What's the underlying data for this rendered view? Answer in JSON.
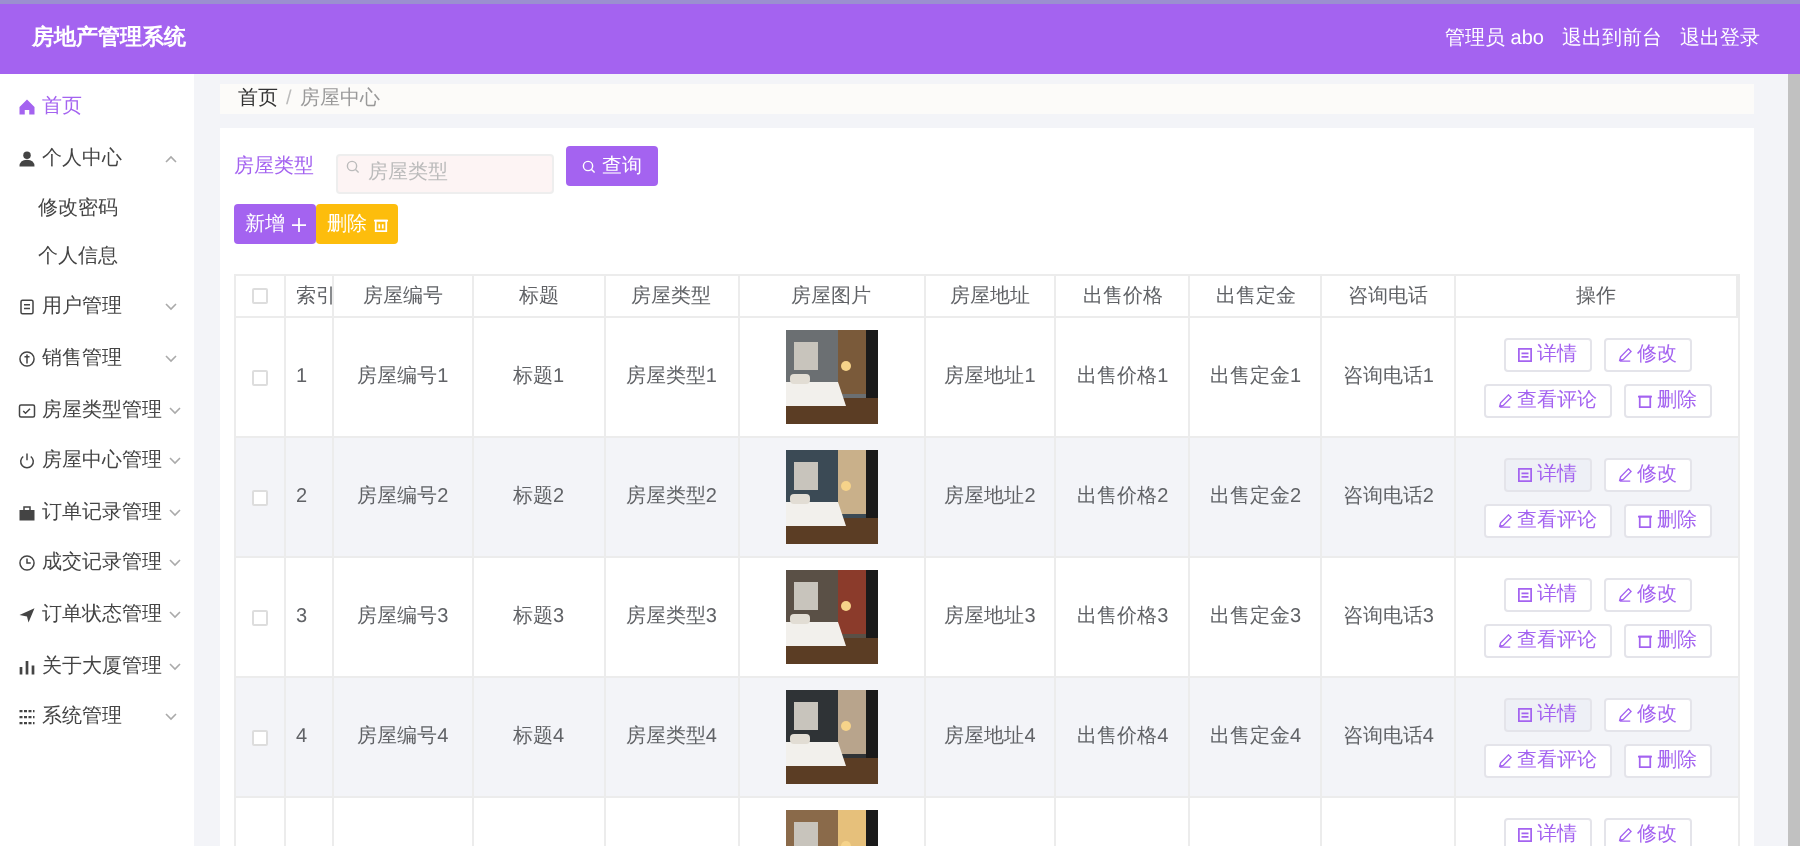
{
  "header": {
    "title": "房地产管理系统",
    "links": [
      "管理员 abo",
      "退出到前台",
      "退出登录"
    ]
  },
  "sidebar": {
    "items": [
      {
        "label": "首页",
        "selected": true
      },
      {
        "label": "个人中心",
        "selected": false,
        "expanded": true,
        "children": [
          {
            "label": "修改密码",
            "selected": false
          },
          {
            "label": "个人信息",
            "selected": false
          }
        ]
      },
      {
        "label": "用户管理",
        "selected": false,
        "expanded": false
      },
      {
        "label": "销售管理",
        "selected": false,
        "expanded": false
      },
      {
        "label": "房屋类型管理",
        "selected": false,
        "expanded": false
      },
      {
        "label": "房屋中心管理",
        "selected": false,
        "expanded": false
      },
      {
        "label": "订单记录管理",
        "selected": false,
        "expanded": false
      },
      {
        "label": "成交记录管理",
        "selected": false,
        "expanded": false
      },
      {
        "label": "订单状态管理",
        "selected": false,
        "expanded": false
      },
      {
        "label": "关于大厦管理",
        "selected": false,
        "expanded": false
      },
      {
        "label": "系统管理",
        "selected": false,
        "expanded": false
      }
    ]
  },
  "breadcrumb": {
    "items": [
      "首页",
      "房屋中心"
    ],
    "separator": "/"
  },
  "search": {
    "label": "房屋类型",
    "placeholder": "房屋类型",
    "button": "查询"
  },
  "actions": [
    {
      "label": "新增",
      "kind": "add"
    },
    {
      "label": "删除",
      "kind": "delete"
    }
  ],
  "table": {
    "columns": [
      "索引",
      "房屋编号",
      "标题",
      "房屋类型",
      "房屋图片",
      "房屋地址",
      "出售价格",
      "出售定金",
      "咨询电话",
      "操作"
    ],
    "all_checked": false,
    "rows": [
      {
        "checked": false,
        "cells": [
          "1",
          "房屋编号1",
          "标题1",
          "房屋类型1",
          null,
          "房屋地址1",
          "出售价格1",
          "出售定金1",
          "咨询电话1"
        ],
        "image": {
          "kind": "picture"
        },
        "buttons": [
          "详情",
          "修改",
          "查看评论",
          "删除"
        ]
      },
      {
        "checked": false,
        "cells": [
          "2",
          "房屋编号2",
          "标题2",
          "房屋类型2",
          null,
          "房屋地址2",
          "出售价格2",
          "出售定金2",
          "咨询电话2"
        ],
        "image": {
          "kind": "picture"
        },
        "buttons": [
          "详情",
          "修改",
          "查看评论",
          "删除"
        ]
      },
      {
        "checked": false,
        "cells": [
          "3",
          "房屋编号3",
          "标题3",
          "房屋类型3",
          null,
          "房屋地址3",
          "出售价格3",
          "出售定金3",
          "咨询电话3"
        ],
        "image": {
          "kind": "picture"
        },
        "buttons": [
          "详情",
          "修改",
          "查看评论",
          "删除"
        ]
      },
      {
        "checked": false,
        "cells": [
          "4",
          "房屋编号4",
          "标题4",
          "房屋类型4",
          null,
          "房屋地址4",
          "出售价格4",
          "出售定金4",
          "咨询电话4"
        ],
        "image": {
          "kind": "picture"
        },
        "buttons": [
          "详情",
          "修改",
          "查看评论",
          "删除"
        ]
      },
      {
        "image": {
          "kind": "picture"
        },
        "buttons": [
          "详情",
          "修改"
        ]
      }
    ]
  }
}
